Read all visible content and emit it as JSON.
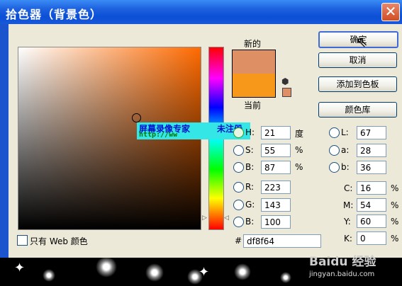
{
  "window": {
    "title": "拾色器（背景色）",
    "close_glyph": "✕"
  },
  "swatch": {
    "new_label": "新的",
    "current_label": "当前",
    "new_color": "#df8f64",
    "current_color": "#f7981a"
  },
  "buttons": {
    "ok": "确定",
    "cancel": "取消",
    "add_swatch": "添加到色板",
    "color_library": "颜色库"
  },
  "overlay": {
    "line1": "屏幕录像专家",
    "line1b": "未注册",
    "line2": "http://ww"
  },
  "fields": {
    "H": {
      "label": "H:",
      "value": "21",
      "unit": "度"
    },
    "S": {
      "label": "S:",
      "value": "55",
      "unit": "%"
    },
    "Bri": {
      "label": "B:",
      "value": "87",
      "unit": "%"
    },
    "R": {
      "label": "R:",
      "value": "223"
    },
    "G": {
      "label": "G:",
      "value": "143"
    },
    "Bl": {
      "label": "B:",
      "value": "100"
    },
    "L": {
      "label": "L:",
      "value": "67"
    },
    "a": {
      "label": "a:",
      "value": "28"
    },
    "b": {
      "label": "b:",
      "value": "36"
    },
    "C": {
      "label": "C:",
      "value": "16",
      "unit": "%"
    },
    "M": {
      "label": "M:",
      "value": "54",
      "unit": "%"
    },
    "Y": {
      "label": "Y:",
      "value": "60",
      "unit": "%"
    },
    "K": {
      "label": "K:",
      "value": "0",
      "unit": "%"
    }
  },
  "hex": {
    "symbol": "#",
    "value": "df8f64"
  },
  "web_only": {
    "label": "只有 Web 颜色"
  },
  "watermark": {
    "brand": "Baidu 经验",
    "url": "jingyan.baidu.com"
  },
  "colors": {
    "titlebar": "#0b4fd6",
    "field_hue": "#ff6a00",
    "dialog_bg": "#ece9d8"
  }
}
